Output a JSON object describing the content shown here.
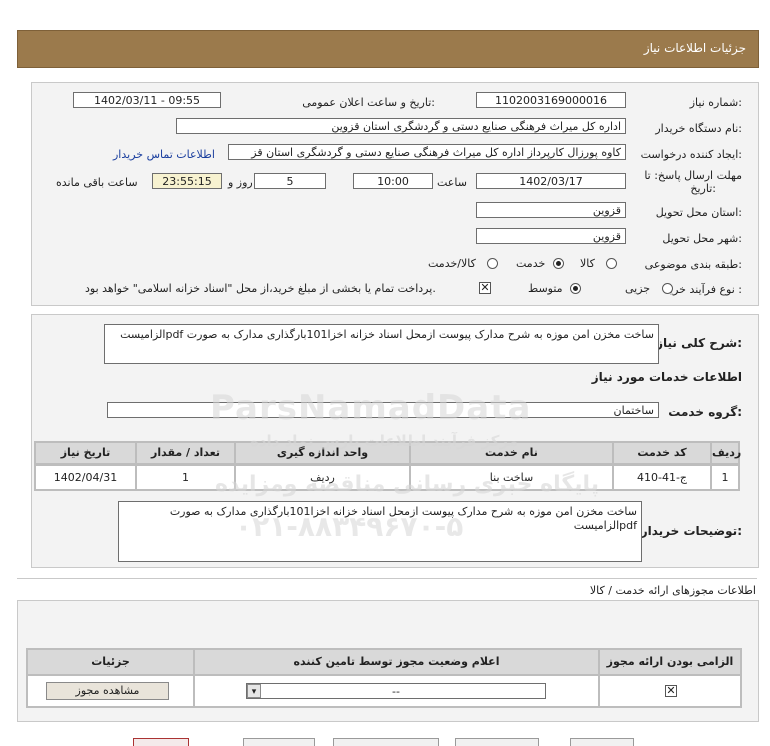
{
  "header": {
    "title": "جزئیات اطلاعات نیاز"
  },
  "fields": {
    "need_number_label": "شماره نیاز:",
    "need_number_value": "1102003169000016",
    "announce_label": "تاریخ و ساعت اعلان عمومی:",
    "announce_value": "1402/03/11 - 09:55",
    "buyer_org_label": "نام دستگاه خریدار:",
    "buyer_org_value": "اداره کل میراث فرهنگی  صنایع دستی و گردشگری استان قزوین",
    "creator_label": "ایجاد کننده درخواست:",
    "creator_value": "کاوه پورزال کارپرداز اداره کل میراث فرهنگی  صنایع دستی و گردشگری استان قز",
    "contact_link": "اطلاعات تماس خریدار",
    "deadline_label_1": "مهلت ارسال پاسخ: تا",
    "deadline_label_2": "تاریخ:",
    "deadline_date": "1402/03/17",
    "time_label": "ساعت",
    "deadline_time": "10:00",
    "days_value": "5",
    "days_label": "روز و",
    "remaining_value": "23:55:15",
    "remaining_label": "ساعت باقی مانده",
    "province_label": "استان محل تحویل:",
    "province_value": "قزوین",
    "city_label": "شهر محل تحویل:",
    "city_value": "قزوین",
    "category_label": "طبقه بندی موضوعی:",
    "category_options": [
      {
        "label": "کالا",
        "selected": false
      },
      {
        "label": "خدمت",
        "selected": true
      },
      {
        "label": "کالا/خدمت",
        "selected": false
      }
    ],
    "process_label": "نوع فرآیند خرید :",
    "process_options": [
      {
        "label": "جزیی",
        "selected": false
      },
      {
        "label": "متوسط",
        "selected": true
      }
    ],
    "payment_note": "پرداخت تمام یا بخشی از مبلغ خرید،از محل \"اسناد خزانه اسلامی\" خواهد بود."
  },
  "summary": {
    "label": "شرح کلی نیاز:",
    "text": "ساخت مخزن امن موزه به شرح مدارک پیوست ازمحل اسناد خزانه اخزا101بارگذاری مدارک به صورت pdfالزامیست"
  },
  "services": {
    "section_title": "اطلاعات خدمات مورد نیاز",
    "group_label": "گروه خدمت:",
    "group_value": "ساختمان",
    "table": {
      "headers": [
        "ردیف",
        "کد خدمت",
        "نام خدمت",
        "واحد اندازه گیری",
        "تعداد / مقدار",
        "تاریخ نیاز"
      ],
      "rows": [
        [
          "1",
          "ج-41-410",
          "ساخت بنا",
          "ردیف",
          "1",
          "1402/04/31"
        ]
      ]
    },
    "buyer_notes_label": "توضیحات خریدار:",
    "buyer_notes_text": "ساخت مخزن امن موزه به شرح مدارک پیوست ازمحل اسناد خزانه اخزا101بارگذاری مدارک به صورت pdfالزامیست"
  },
  "permits": {
    "section_title": "اطلاعات مجوزهای ارائه خدمت / کالا",
    "headers": [
      "الزامی بودن ارائه مجوز",
      "اعلام وضعیت مجوز توسط تامین کننده",
      "جزئیات"
    ],
    "select_value": "--",
    "view_button": "مشاهده مجوز"
  },
  "watermark": {
    "line1": "ParsNamadData",
    "line2": "مرکز فرآیند اطلاعات پارس نماد داده",
    "line3": "پایگاه خبری رسانی مناقصه ومزایده",
    "line4": "۰۲۱-۸۸۳۴۹۶۷۰-۵"
  },
  "colors": {
    "header": "#9b7a4c",
    "link": "#1a3e9e",
    "yellow": "#f7f2d0"
  }
}
